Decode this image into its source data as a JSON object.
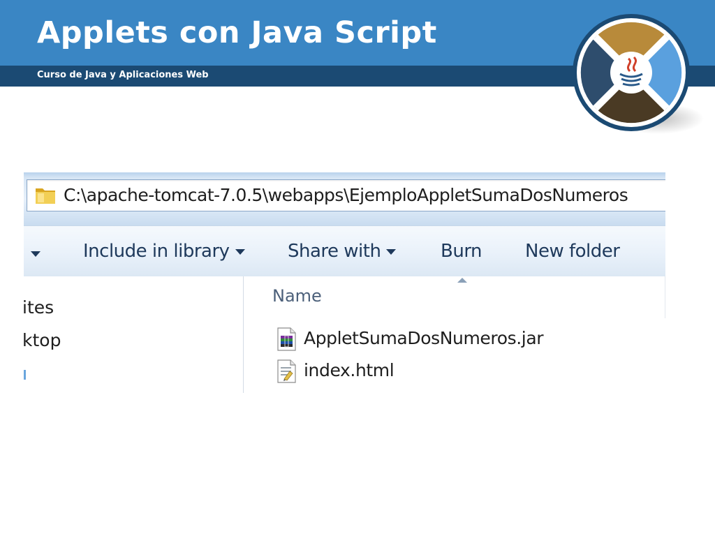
{
  "slide": {
    "title": "Applets con Java Script",
    "subtitle": "Curso de Java y Aplicaciones Web"
  },
  "colors": {
    "header_blue": "#3a86c4",
    "header_band": "#1b4a73",
    "toolbar_text": "#1e395b"
  },
  "explorer": {
    "address": {
      "icon": "folder-icon",
      "path": "C:\\apache-tomcat-7.0.5\\webapps\\EjemploAppletSumaDosNumeros"
    },
    "toolbar": {
      "include_in_library": "Include in library",
      "share_with": "Share with",
      "burn": "Burn",
      "new_folder": "New folder"
    },
    "nav": {
      "items": [
        "ites",
        "ktop"
      ]
    },
    "files": {
      "column_name": "Name",
      "rows": [
        {
          "name": "AppletSumaDosNumeros.jar",
          "icon": "archive-icon"
        },
        {
          "name": "index.html",
          "icon": "html-file-icon"
        }
      ]
    }
  }
}
